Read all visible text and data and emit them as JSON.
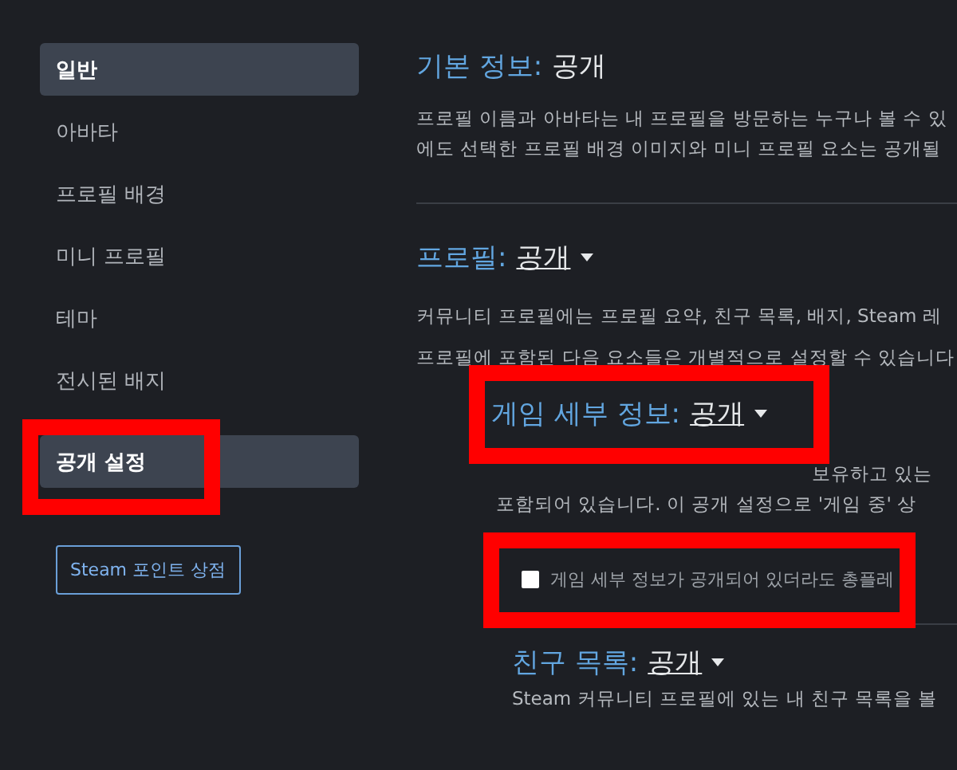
{
  "sidebar": {
    "items": [
      {
        "label": "일반",
        "selected": true,
        "annotated": false
      },
      {
        "label": "아바타",
        "selected": false,
        "annotated": false
      },
      {
        "label": "프로필 배경",
        "selected": false,
        "annotated": false
      },
      {
        "label": "미니 프로필",
        "selected": false,
        "annotated": false
      },
      {
        "label": "테마",
        "selected": false,
        "annotated": false
      },
      {
        "label": "전시된 배지",
        "selected": false,
        "annotated": false
      },
      {
        "label": "공개 설정",
        "selected": true,
        "annotated": true
      }
    ],
    "button": "Steam 포인트 상점"
  },
  "basic": {
    "label": "기본 정보:",
    "value": "공개",
    "lines": [
      "프로필 이름과 아바타는 내 프로필을 방문하는 누구나 볼 수 있",
      "에도 선택한 프로필 배경 이미지와 미니 프로필 요소는 공개될"
    ]
  },
  "profile": {
    "label": "프로필:",
    "value": "공개",
    "lines": [
      "커뮤니티 프로필에는 프로필 요약, 친구 목록, 배지, Steam 레",
      "프로필에 포함된 다음 요소들은 개별적으로 설정할 수 있습니다"
    ]
  },
  "game_details": {
    "label": "게임 세부 정보:",
    "value": "공개",
    "annotated": true,
    "lines": [
      "보유하고 있는",
      "포함되어 있습니다. 이 공개 설정으로 '게임 중' 상"
    ],
    "checkbox": {
      "label": "게임 세부 정보가 공개되어 있더라도 총플레",
      "checked": false,
      "annotated": true
    }
  },
  "friends": {
    "label": "친구 목록:",
    "value": "공개",
    "lines": [
      "Steam 커뮤니티 프로필에 있는 내 친구 목록을 볼"
    ]
  }
}
